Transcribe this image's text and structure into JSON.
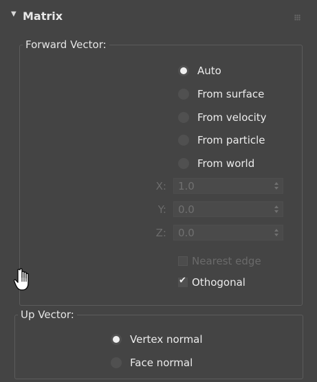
{
  "rollout": {
    "title": "Matrix",
    "arrow_icon": "triangle-down-icon"
  },
  "forward_vector": {
    "label": "Forward Vector:",
    "options": [
      {
        "label": "Auto",
        "selected": true
      },
      {
        "label": "From surface",
        "selected": false
      },
      {
        "label": "From velocity",
        "selected": false
      },
      {
        "label": "From particle",
        "selected": false
      },
      {
        "label": "From world",
        "selected": false
      }
    ],
    "x": {
      "label": "X:",
      "value": "1.0",
      "enabled": false
    },
    "y": {
      "label": "Y:",
      "value": "0.0",
      "enabled": false
    },
    "z": {
      "label": "Z:",
      "value": "0.0",
      "enabled": false
    },
    "nearest_edge": {
      "label": "Nearest edge",
      "checked": false,
      "enabled": false
    },
    "othogonal": {
      "label": "Othogonal",
      "checked": true,
      "enabled": true
    }
  },
  "up_vector": {
    "label": "Up Vector:",
    "options": [
      {
        "label": "Vertex normal",
        "selected": true
      },
      {
        "label": "Face normal",
        "selected": false
      }
    ]
  },
  "colors": {
    "background": "#444444",
    "border": "#5c5c5c",
    "text": "#e6e6e6",
    "disabled_text": "#6c6c6c"
  },
  "cursor_icon": "hand-pointer-icon"
}
